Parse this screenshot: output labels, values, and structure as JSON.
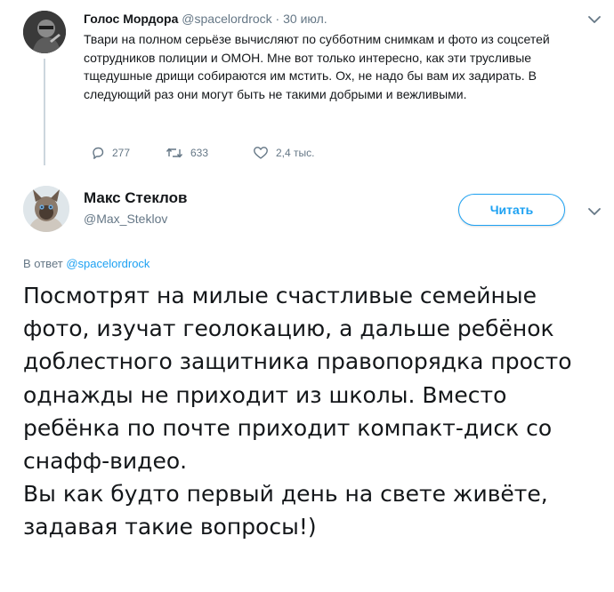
{
  "parent_tweet": {
    "author_name": "Голос Мордора",
    "author_handle": "@spacelordrock",
    "separator": " · ",
    "date": "30 июл.",
    "text": "Твари на полном серьёзе вычисляют по субботним снимкам и фото из соцсетей сотрудников полиции и ОМОН. Мне вот только интересно, как эти трусливые тщедушные дрищи собираются им мстить. Ох, не надо бы вам их задирать. В следующий раз они могут быть не такими добрыми и вежливыми.",
    "actions": {
      "replies": "277",
      "retweets": "633",
      "likes": "2,4 тыс."
    }
  },
  "main_tweet": {
    "author_name": "Макс Стеклов",
    "author_handle": "@Max_Steklov",
    "follow_label": "Читать",
    "reply_prefix": "В ответ ",
    "reply_mention": "@spacelordrock",
    "paragraphs": [
      "Посмотрят на милые счастливые семейные фото, изучат геолокацию, а дальше ребёнок доблестного защитника правопорядка просто однажды не приходит из школы. Вместо ребёнка по почте приходит компакт-диск со снафф-видео.",
      "Вы как будто первый день на свете живёте, задавая такие вопросы!)"
    ]
  },
  "colors": {
    "accent": "#1da1f2",
    "text": "#14171a",
    "muted": "#657786",
    "connector": "#ccd6dd"
  },
  "icons": [
    "reply-icon",
    "retweet-icon",
    "like-icon",
    "chevron-down-icon"
  ]
}
